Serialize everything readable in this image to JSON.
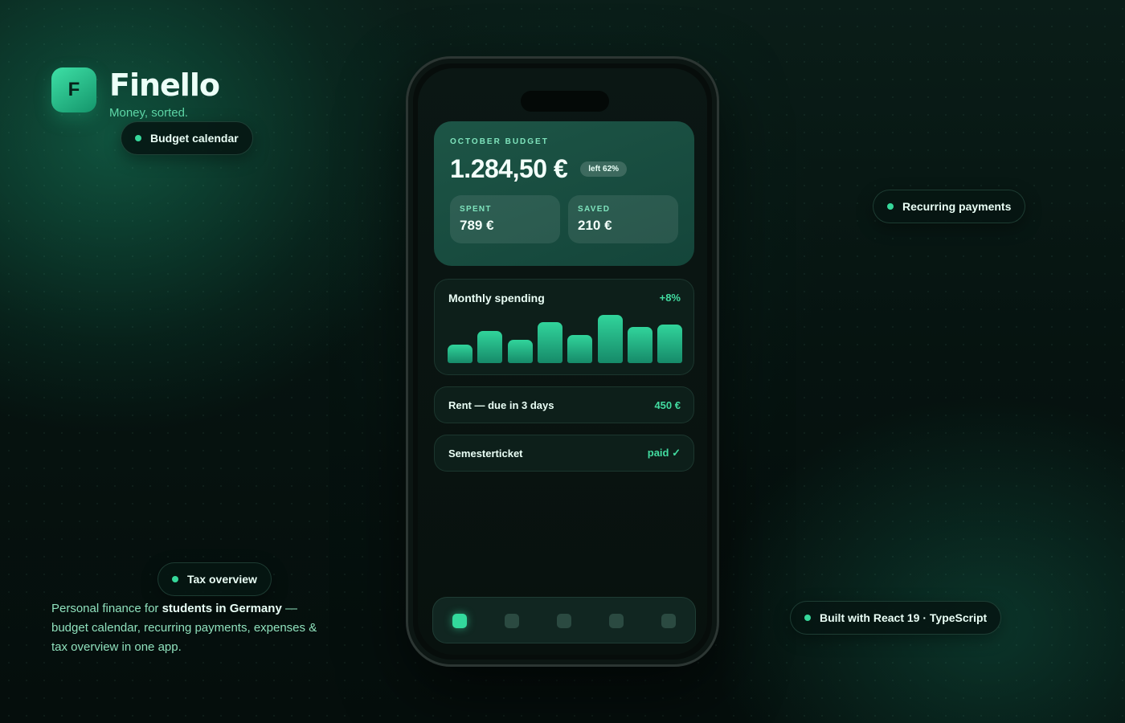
{
  "brand": {
    "logo_letter": "F",
    "name": "Finello",
    "tagline": "Money, sorted."
  },
  "features": {
    "budget_calendar": "Budget calendar",
    "recurring_payments": "Recurring payments",
    "tax_overview": "Tax overview",
    "tech_stack": "Built with React 19 · TypeScript"
  },
  "description": {
    "prefix": "Personal finance for ",
    "highlight": "students in Germany",
    "suffix": " — budget calendar, recurring payments, expenses & tax overview in one app."
  },
  "phone": {
    "budget": {
      "label": "OCTOBER BUDGET",
      "amount": "1.284,50 €",
      "left_badge": "left 62%",
      "spent_label": "SPENT",
      "spent_value": "789 €",
      "saved_label": "SAVED",
      "saved_value": "210 €"
    },
    "spending": {
      "title": "Monthly spending",
      "change": "+8%"
    },
    "rows": [
      {
        "label": "Rent — due in 3 days",
        "value": "450 €"
      },
      {
        "label": "Semesterticket",
        "value": "paid ✓"
      }
    ],
    "nav": {
      "active_index": 0,
      "count": 5
    }
  },
  "chart_data": {
    "type": "bar",
    "title": "Monthly spending",
    "values": [
      0.38,
      0.66,
      0.49,
      0.85,
      0.58,
      1.0,
      0.75,
      0.8
    ]
  },
  "colors": {
    "accent": "#33d99c",
    "background": "#050c0a",
    "card": "#0d1f1a",
    "budget_card": "#1d5546"
  }
}
